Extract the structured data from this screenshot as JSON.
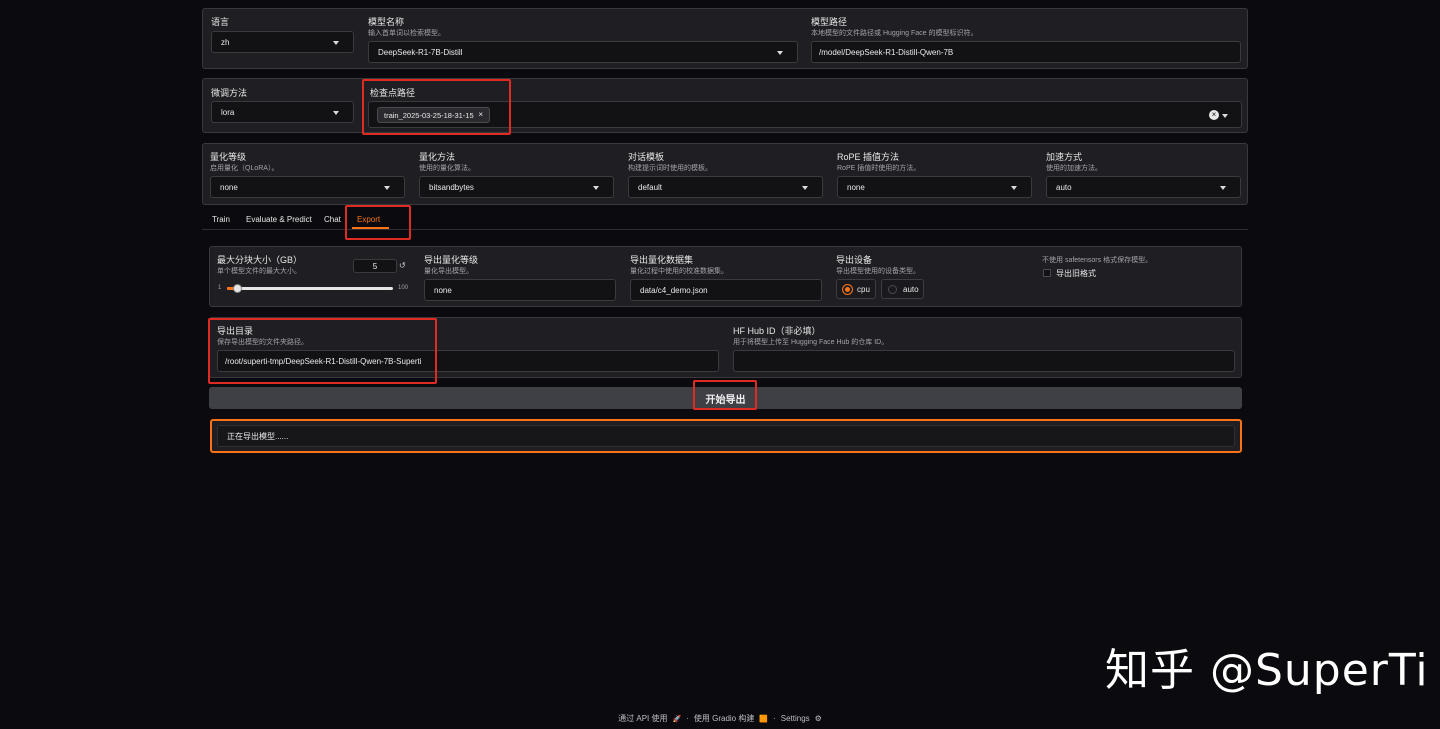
{
  "model_row": {
    "lang_label": "语言",
    "lang_value": "zh",
    "model_name_label": "模型名称",
    "model_name_sub": "输入首单词以检索模型。",
    "model_name_value": "DeepSeek-R1-7B-Distill",
    "model_path_label": "模型路径",
    "model_path_sub": "本地模型的文件路径或 Hugging Face 的模型标识符。",
    "model_path_value": "/model/DeepSeek-R1-Distill-Qwen-7B"
  },
  "finetune_row": {
    "method_label": "微调方法",
    "method_value": "lora",
    "ckpt_label": "检查点路径",
    "ckpt_chip": "train_2025-03-25-18-31-15",
    "chip_close": "×",
    "clear_icon": "×"
  },
  "quant_row": {
    "items": [
      {
        "label": "量化等级",
        "sub": "启用量化（QLoRA）。",
        "value": "none"
      },
      {
        "label": "量化方法",
        "sub": "使用的量化算法。",
        "value": "bitsandbytes"
      },
      {
        "label": "对话模板",
        "sub": "构建提示词时使用的模板。",
        "value": "default"
      },
      {
        "label": "RoPE 插值方法",
        "sub": "RoPE 插值时使用的方法。",
        "value": "none"
      },
      {
        "label": "加速方式",
        "sub": "使用的加速方法。",
        "value": "auto"
      }
    ]
  },
  "tabs": [
    "Train",
    "Evaluate & Predict",
    "Chat",
    "Export"
  ],
  "active_tab": "Export",
  "export": {
    "shard_label": "最大分块大小（GB）",
    "shard_sub": "单个模型文件的最大大小。",
    "shard_value": "5",
    "reset_icon": "↺",
    "slider_min": "1",
    "slider_max": "100",
    "slider_fraction": 0.04,
    "quant_bit_label": "导出量化等级",
    "quant_bit_sub": "量化导出模型。",
    "quant_bit_value": "none",
    "dataset_label": "导出量化数据集",
    "dataset_sub": "量化过程中使用的校准数据集。",
    "dataset_value": "data/c4_demo.json",
    "device_label": "导出设备",
    "device_sub": "导出模型使用的设备类型。",
    "device_options": [
      "cpu",
      "auto"
    ],
    "device_selected": "cpu",
    "legacy_note": "不使用 safetensors 格式保存模型。",
    "legacy_label": "导出旧格式",
    "dir_label": "导出目录",
    "dir_sub": "保存导出模型的文件夹路径。",
    "dir_value": "/root/superti-tmp/DeepSeek-R1-Distill-Qwen-7B-Superti",
    "hub_label": "HF Hub ID（非必填）",
    "hub_sub": "用于将模型上传至 Hugging Face Hub 的仓库 ID。",
    "hub_value": "",
    "start_button": "开始导出",
    "status_text": "正在导出模型......"
  },
  "watermark": "知乎 @SuperTi",
  "footer": {
    "api": "通过 API 使用",
    "api_icon": "🚀",
    "dot1": "·",
    "gradio": "使用 Gradio 构建",
    "gradio_icon": "🟧",
    "dot2": "·",
    "settings": "Settings",
    "settings_icon": "⚙"
  },
  "colors": {
    "accent": "#f97316",
    "highlight": "#e02a22",
    "panel": "#1f1f23",
    "background": "#0b0b0f"
  }
}
